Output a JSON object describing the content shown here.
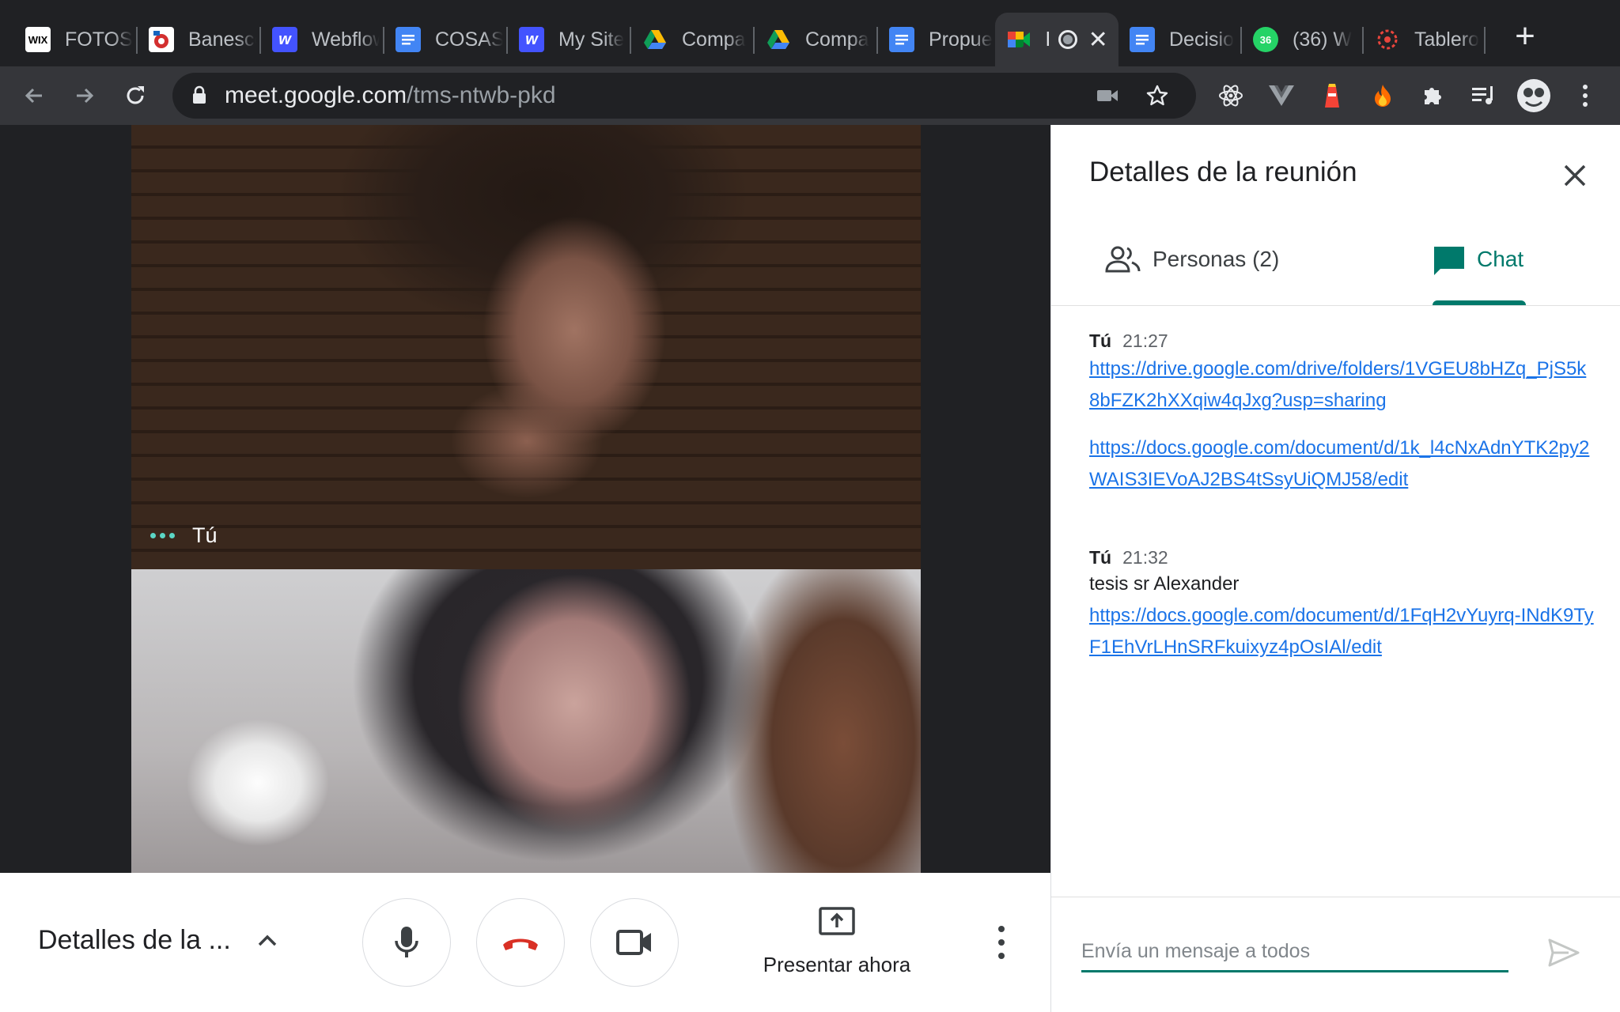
{
  "browser": {
    "tabs": [
      {
        "title": "FOTOS",
        "icon": "wix-icon"
      },
      {
        "title": "Banesco",
        "icon": "banesco-icon"
      },
      {
        "title": "Webflow",
        "icon": "webflow-icon"
      },
      {
        "title": "COSAS",
        "icon": "google-docs-icon"
      },
      {
        "title": "My Site",
        "icon": "webflow-icon"
      },
      {
        "title": "Compa",
        "icon": "google-drive-icon"
      },
      {
        "title": "Compa",
        "icon": "google-drive-icon"
      },
      {
        "title": "Propue",
        "icon": "google-docs-icon"
      },
      {
        "title": "l",
        "icon": "google-meet-icon",
        "active": true
      },
      {
        "title": "Decisio",
        "icon": "google-docs-icon"
      },
      {
        "title": "(36) W",
        "icon": "whatsapp-icon",
        "badge": "36"
      },
      {
        "title": "Tablero",
        "icon": "asana-icon"
      }
    ],
    "url_host": "meet.google.com",
    "url_path": "/tms-ntwb-pkd"
  },
  "meeting": {
    "self_label": "Tú",
    "details_label": "Detalles de la ...",
    "present_label": "Presentar ahora"
  },
  "panel": {
    "title": "Detalles de la reunión",
    "tab_people": "Personas (2)",
    "tab_chat": "Chat",
    "messages": [
      {
        "sender": "Tú",
        "time": "21:27",
        "links": [
          "https://drive.google.com/drive/folders/1VGEU8bHZq_PjS5k8bFZK2hXXqiw4qJxg?usp=sharing",
          "https://docs.google.com/document/d/1k_l4cNxAdnYTK2py2WAIS3IEVoAJ2BS4tSsyUiQMJ58/edit"
        ]
      },
      {
        "sender": "Tú",
        "time": "21:32",
        "text": "tesis sr Alexander",
        "links": [
          "https://docs.google.com/document/d/1FqH2vYuyrq-INdK9TyF1EhVrLHnSRFkuixyz4pOsIAl/edit"
        ]
      }
    ],
    "composer_placeholder": "Envía un mensaje a todos"
  },
  "colors": {
    "accent": "#00796b",
    "link": "#1a73e8",
    "hangup": "#d93025",
    "chrome_dark": "#202124"
  }
}
